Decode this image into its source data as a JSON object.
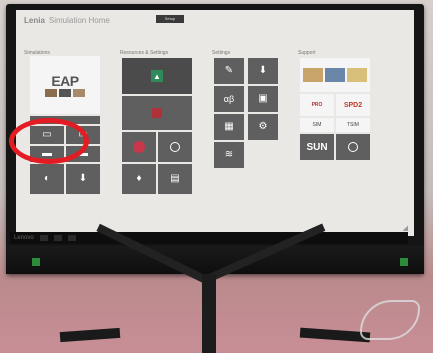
{
  "window": {
    "brand": "Lenia",
    "title": "Simulation Home",
    "top_button": "Setup"
  },
  "sections": {
    "simulations": "Simulations",
    "resources": "Resources & Settings",
    "settings": "Settings",
    "support": "Support"
  },
  "tiles": {
    "eap_logo": "EAP",
    "eap_caption": "EAP",
    "sun_label": "SUN",
    "alpha_beta": "αβ",
    "spd2_label": "SPD2",
    "pro_label": "PRO",
    "sim_label": "SIM",
    "tsim_label": "TSIM"
  },
  "taskbar": {
    "brand": "Lenovo"
  },
  "colors": {
    "accent_green": "#2f8b5a",
    "accent_red": "#b0313a",
    "highlight_ring": "#e31b23"
  }
}
